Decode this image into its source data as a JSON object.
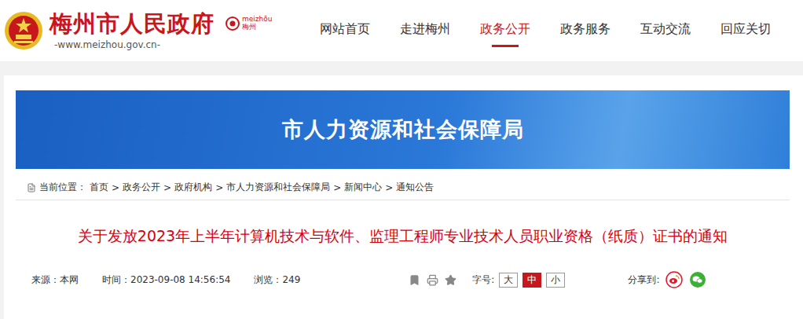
{
  "header": {
    "title": "梅州市人民政府",
    "url": "-www.meizhou.gov.cn-",
    "logo": {
      "latin": "meizhōu",
      "chinese": "梅州"
    }
  },
  "nav": [
    {
      "label": "网站首页",
      "selected": false
    },
    {
      "label": "走进梅州",
      "selected": false
    },
    {
      "label": "政务公开",
      "selected": true
    },
    {
      "label": "政务服务",
      "selected": false
    },
    {
      "label": "互动交流",
      "selected": false
    },
    {
      "label": "回应关切",
      "selected": false
    }
  ],
  "banner": {
    "title": "市人力资源和社会保障局"
  },
  "breadcrumb": {
    "label": "当前位置：",
    "separator": ">",
    "items": [
      "首页",
      "政务公开",
      "政府机构",
      "市人力资源和社会保障局",
      "新闻中心",
      "通知公告"
    ]
  },
  "article": {
    "title": "关于发放2023年上半年计算机技术与软件、监理工程师专业技术人员职业资格（纸质）证书的通知",
    "meta": {
      "source": "来源：本网",
      "time": "时间：2023-09-08 14:56:54",
      "views": "浏览：249"
    },
    "font_size": {
      "label": "字号:",
      "sizes": [
        {
          "label": "大",
          "selected": false
        },
        {
          "label": "中",
          "selected": true
        },
        {
          "label": "小",
          "selected": false
        }
      ]
    },
    "share": {
      "label": "分享到:"
    }
  }
}
